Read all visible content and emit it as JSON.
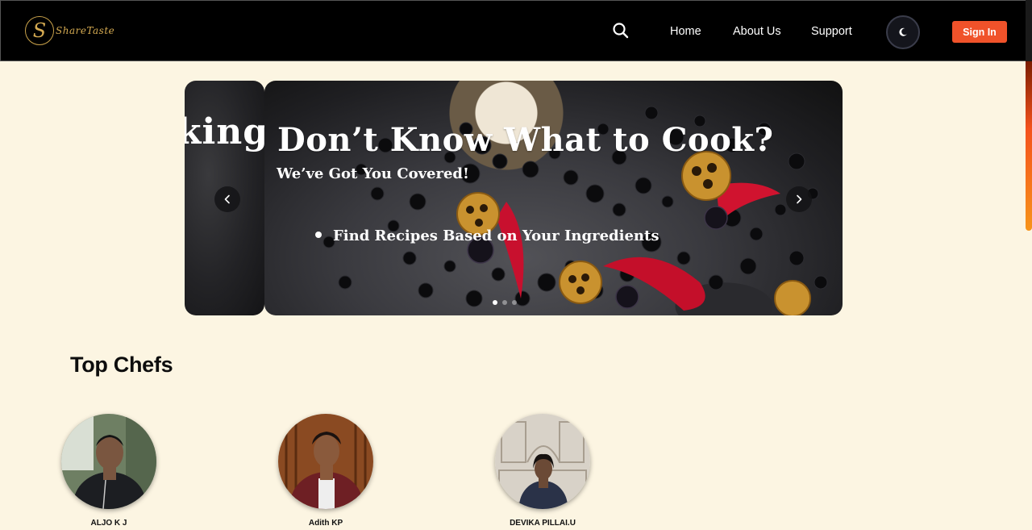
{
  "brand": {
    "name": "ShareTaste",
    "mark": "S"
  },
  "nav": {
    "links": [
      "Home",
      "About Us",
      "Support"
    ],
    "sign_in_label": "Sign In",
    "icons": {
      "search": "search-icon",
      "theme": "moon-icon"
    }
  },
  "carousel": {
    "prev_slide_text": "king",
    "headline": "Don’t Know What to Cook?",
    "subheadline": "We’ve Got You Covered!",
    "bullet": "Find Recipes Based on Your Ingredients",
    "slide_count": 3,
    "active_index": 0
  },
  "top_chefs": {
    "title": "Top Chefs",
    "chefs": [
      {
        "name": "ALJO K J"
      },
      {
        "name": "Adith KP"
      },
      {
        "name": "DEVIKA PILLAI.U"
      }
    ]
  },
  "colors": {
    "page_bg": "#fcf5e2",
    "navbar_bg": "#000000",
    "accent": "#f0522a",
    "logo_gold": "#d6ab52"
  }
}
